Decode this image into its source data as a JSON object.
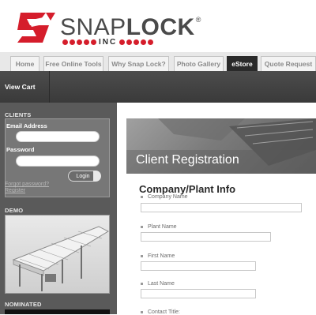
{
  "brand": {
    "name_light": "SNAP",
    "name_bold": "LOCK",
    "registered": "®",
    "sub": "INC",
    "accent_color": "#d51d2b"
  },
  "nav": {
    "tabs": [
      {
        "label": "Home"
      },
      {
        "label": "Free Online Tools"
      },
      {
        "label": "Why Snap Lock?"
      },
      {
        "label": "Photo Gallery"
      },
      {
        "label": "eStore",
        "active": true
      },
      {
        "label": "Quote Request"
      }
    ],
    "view_cart": "View Cart"
  },
  "sidebar": {
    "clients_title": "CLIENTS",
    "email_label": "Email Address",
    "password_label": "Password",
    "login_label": "Login",
    "forgot_label": "Forgot password?",
    "register_label": "Register",
    "demo_title": "DEMO",
    "nominated_title": "NOMINATED"
  },
  "main": {
    "banner_title": "Client Registration",
    "section_title": "Company/Plant Info",
    "fields": [
      {
        "label": "Company Name"
      },
      {
        "label": "Plant Name"
      },
      {
        "label": "First Name"
      },
      {
        "label": "Last Name"
      },
      {
        "label": "Contact Title:"
      }
    ]
  }
}
